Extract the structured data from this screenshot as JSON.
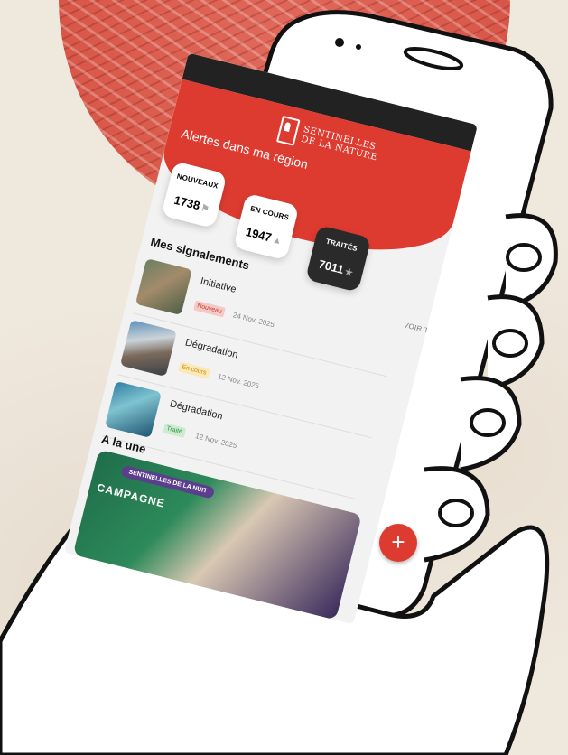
{
  "app": {
    "logo_line1": "SENTINELLES",
    "logo_line2": "DE LA NATURE",
    "region_title": "Alertes dans ma région"
  },
  "stats": [
    {
      "label": "NOUVEAUX",
      "value": "1738",
      "icon": "flag-icon"
    },
    {
      "label": "EN COURS",
      "value": "1947",
      "icon": "rocket-icon"
    },
    {
      "label": "TRAITÉS",
      "value": "7011",
      "icon": "star-icon"
    }
  ],
  "reports": {
    "title": "Mes signalements",
    "see_all": "VOIR TOUT",
    "items": [
      {
        "title": "Initiative",
        "status": "Nouveau",
        "date": "24 Nov. 2025"
      },
      {
        "title": "Dégradation",
        "status": "En cours",
        "date": "12 Nov. 2025"
      },
      {
        "title": "Dégradation",
        "status": "Traité",
        "date": "12 Nov. 2025"
      }
    ]
  },
  "featured": {
    "title": "A la une",
    "card_tag": "SENTINELLES DE LA NUIT",
    "card_title": "CAMPAGNE"
  },
  "fab_label": "+",
  "colors": {
    "accent": "#de3b30",
    "dark": "#2a2a2a",
    "background": "#efe8dd"
  }
}
